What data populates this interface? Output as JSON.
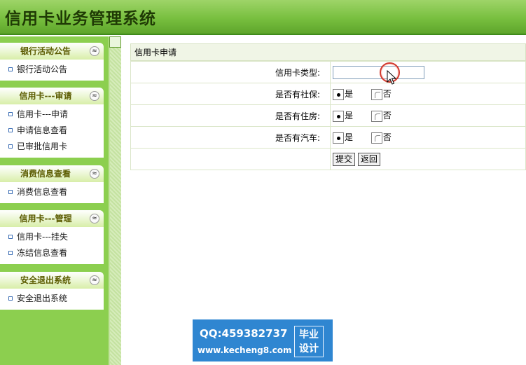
{
  "header": {
    "title": "信用卡业务管理系统"
  },
  "sidebar": {
    "panels": [
      {
        "title": "银行活动公告",
        "items": [
          "银行活动公告"
        ]
      },
      {
        "title": "信用卡---审请",
        "items": [
          "信用卡---申请",
          "申请信息查看",
          "已审批信用卡"
        ]
      },
      {
        "title": "消费信息查看",
        "items": [
          "消费信息查看"
        ]
      },
      {
        "title": "信用卡---管理",
        "items": [
          "信用卡---挂失",
          "冻结信息查看"
        ]
      },
      {
        "title": "安全退出系统",
        "items": [
          "安全退出系统"
        ]
      }
    ],
    "collapse_glyph": "≈"
  },
  "form": {
    "title": "信用卡申请",
    "card_type_label": "信用卡类型:",
    "card_type_value": "",
    "social_label": "是否有社保:",
    "housing_label": "是否有住房:",
    "car_label": "是否有汽车:",
    "yes": "是",
    "no": "否",
    "social_selected": "是",
    "housing_selected": "是",
    "car_selected": "是",
    "submit_label": "提交",
    "back_label": "返回"
  },
  "watermark": {
    "qq": "QQ:459382737",
    "url": "www.kecheng8.com",
    "badge_line1": "毕业",
    "badge_line2": "设计"
  }
}
